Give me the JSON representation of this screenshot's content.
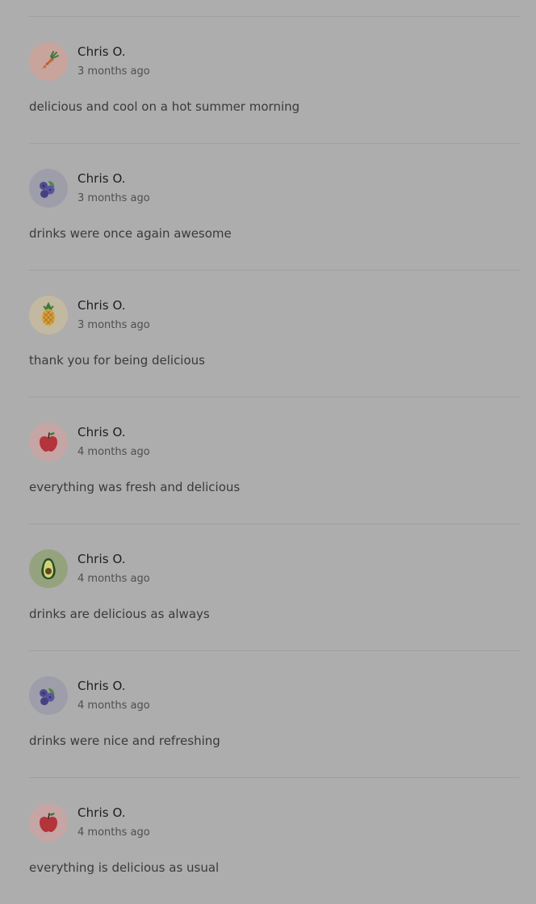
{
  "reviews": [
    {
      "author": "Chris O.",
      "time": "3 months ago",
      "comment": "delicious and cool on a hot summer morning",
      "avatar_icon": "carrot-icon",
      "avatar_bg": "#c9a49d"
    },
    {
      "author": "Chris O.",
      "time": "3 months ago",
      "comment": "drinks were once again awesome",
      "avatar_icon": "blueberry-icon",
      "avatar_bg": "#9e9eab"
    },
    {
      "author": "Chris O.",
      "time": "3 months ago",
      "comment": "thank you for being delicious",
      "avatar_icon": "pineapple-icon",
      "avatar_bg": "#c2b9a0"
    },
    {
      "author": "Chris O.",
      "time": "4 months ago",
      "comment": "everything was fresh and delicious",
      "avatar_icon": "apple-icon",
      "avatar_bg": "#c6a5a5"
    },
    {
      "author": "Chris O.",
      "time": "4 months ago",
      "comment": "drinks are delicious as always",
      "avatar_icon": "avocado-icon",
      "avatar_bg": "#95a27e"
    },
    {
      "author": "Chris O.",
      "time": "4 months ago",
      "comment": "drinks were nice and refreshing",
      "avatar_icon": "blueberry-icon",
      "avatar_bg": "#9e9eab"
    },
    {
      "author": "Chris O.",
      "time": "4 months ago",
      "comment": "everything is delicious as usual",
      "avatar_icon": "apple-icon",
      "avatar_bg": "#c6a5a5"
    }
  ]
}
